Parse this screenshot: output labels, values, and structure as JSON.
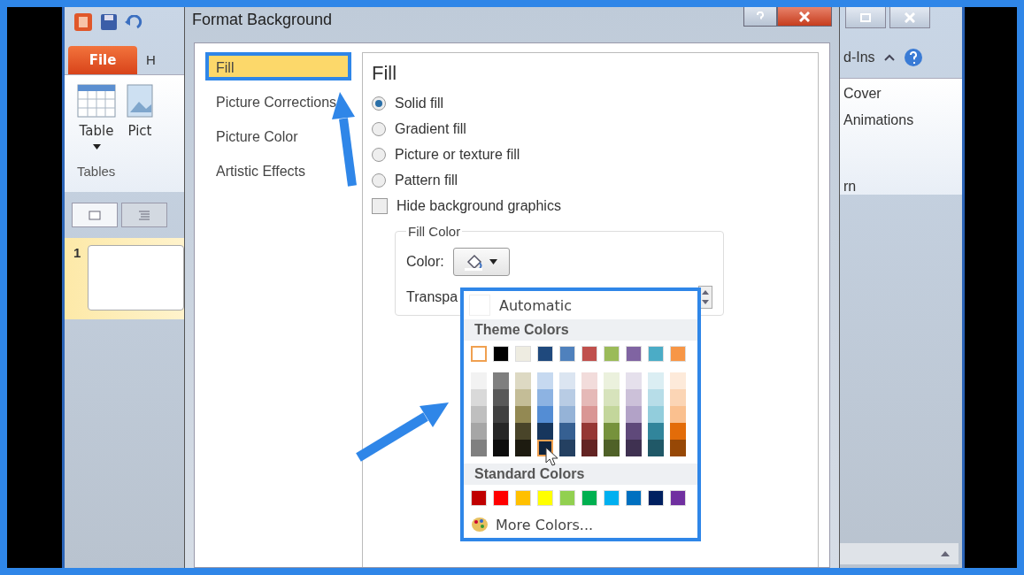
{
  "app": {
    "file_tab": "File",
    "tab_partial": "H",
    "ribbon_buttons": [
      {
        "label": "Table"
      },
      {
        "label": "Pict"
      }
    ],
    "group_label": "Tables",
    "slide_number": "1",
    "right_tab_partial": "d-Ins",
    "right_items": [
      "Cover",
      "Animations"
    ],
    "right_group_partial": "rn"
  },
  "dialog": {
    "title": "Format Background",
    "nav": [
      {
        "label": "Fill",
        "selected": true,
        "highlighted": true
      },
      {
        "label": "Picture Corrections",
        "selected": false,
        "highlighted": false
      },
      {
        "label": "Picture Color",
        "selected": false,
        "highlighted": false
      },
      {
        "label": "Artistic Effects",
        "selected": false,
        "highlighted": false
      }
    ],
    "heading": "Fill",
    "options": [
      {
        "label": "Solid fill",
        "selected": true
      },
      {
        "label": "Gradient fill",
        "selected": false
      },
      {
        "label": "Picture or texture fill",
        "selected": false
      },
      {
        "label": "Pattern fill",
        "selected": false
      }
    ],
    "hide_graphics": {
      "label": "Hide background graphics",
      "checked": false
    },
    "fill_color": {
      "legend": "Fill Color",
      "color_label": "Color:",
      "transparency_label": "Transpa"
    }
  },
  "palette": {
    "highlighted": true,
    "automatic": "Automatic",
    "theme_heading": "Theme Colors",
    "standard_heading": "Standard Colors",
    "more": "More Colors...",
    "theme_colors": [
      {
        "color": "#ffffff",
        "selected": true,
        "shades": [
          {
            "color": "#f2f2f2",
            "selected": false
          },
          {
            "color": "#d9d9d9",
            "selected": false
          },
          {
            "color": "#bfbfbf",
            "selected": false
          },
          {
            "color": "#a6a6a6",
            "selected": false
          },
          {
            "color": "#808080",
            "selected": false
          }
        ]
      },
      {
        "color": "#000000",
        "selected": false,
        "shades": [
          {
            "color": "#7f7f7f",
            "selected": false
          },
          {
            "color": "#595959",
            "selected": false
          },
          {
            "color": "#404040",
            "selected": false
          },
          {
            "color": "#262626",
            "selected": false
          },
          {
            "color": "#0d0d0d",
            "selected": false
          }
        ]
      },
      {
        "color": "#eeece1",
        "selected": false,
        "shades": [
          {
            "color": "#ddd9c3",
            "selected": false
          },
          {
            "color": "#c4bd97",
            "selected": false
          },
          {
            "color": "#938953",
            "selected": false
          },
          {
            "color": "#494429",
            "selected": false
          },
          {
            "color": "#1d1b10",
            "selected": false
          }
        ]
      },
      {
        "color": "#1f497d",
        "selected": false,
        "shades": [
          {
            "color": "#c6d9f0",
            "selected": false
          },
          {
            "color": "#8db3e2",
            "selected": false
          },
          {
            "color": "#548dd4",
            "selected": false
          },
          {
            "color": "#17365d",
            "selected": false
          },
          {
            "color": "#0f243e",
            "selected": true
          }
        ]
      },
      {
        "color": "#4f81bd",
        "selected": false,
        "shades": [
          {
            "color": "#dbe5f1",
            "selected": false
          },
          {
            "color": "#b8cce4",
            "selected": false
          },
          {
            "color": "#95b3d7",
            "selected": false
          },
          {
            "color": "#366092",
            "selected": false
          },
          {
            "color": "#244061",
            "selected": false
          }
        ]
      },
      {
        "color": "#c0504d",
        "selected": false,
        "shades": [
          {
            "color": "#f2dcdb",
            "selected": false
          },
          {
            "color": "#e5b9b7",
            "selected": false
          },
          {
            "color": "#d99694",
            "selected": false
          },
          {
            "color": "#953734",
            "selected": false
          },
          {
            "color": "#632423",
            "selected": false
          }
        ]
      },
      {
        "color": "#9bbb59",
        "selected": false,
        "shades": [
          {
            "color": "#ebf1dd",
            "selected": false
          },
          {
            "color": "#d7e3bc",
            "selected": false
          },
          {
            "color": "#c3d69b",
            "selected": false
          },
          {
            "color": "#76923c",
            "selected": false
          },
          {
            "color": "#4f6128",
            "selected": false
          }
        ]
      },
      {
        "color": "#8064a2",
        "selected": false,
        "shades": [
          {
            "color": "#e5e0ec",
            "selected": false
          },
          {
            "color": "#ccc1d9",
            "selected": false
          },
          {
            "color": "#b2a2c7",
            "selected": false
          },
          {
            "color": "#5f497a",
            "selected": false
          },
          {
            "color": "#3f3151",
            "selected": false
          }
        ]
      },
      {
        "color": "#4bacc6",
        "selected": false,
        "shades": [
          {
            "color": "#dbeef3",
            "selected": false
          },
          {
            "color": "#b7dde8",
            "selected": false
          },
          {
            "color": "#92cddc",
            "selected": false
          },
          {
            "color": "#31859b",
            "selected": false
          },
          {
            "color": "#205867",
            "selected": false
          }
        ]
      },
      {
        "color": "#f79646",
        "selected": false,
        "shades": [
          {
            "color": "#fdeada",
            "selected": false
          },
          {
            "color": "#fbd5b5",
            "selected": false
          },
          {
            "color": "#fac08f",
            "selected": false
          },
          {
            "color": "#e36c09",
            "selected": false
          },
          {
            "color": "#974806",
            "selected": false
          }
        ]
      }
    ],
    "standard_colors": [
      {
        "color": "#c00000",
        "selected": false
      },
      {
        "color": "#ff0000",
        "selected": false
      },
      {
        "color": "#ffc000",
        "selected": false
      },
      {
        "color": "#ffff00",
        "selected": false
      },
      {
        "color": "#92d050",
        "selected": false
      },
      {
        "color": "#00b050",
        "selected": false
      },
      {
        "color": "#00b0f0",
        "selected": false
      },
      {
        "color": "#0070c0",
        "selected": false
      },
      {
        "color": "#002060",
        "selected": false
      },
      {
        "color": "#7030a0",
        "selected": false
      }
    ]
  }
}
